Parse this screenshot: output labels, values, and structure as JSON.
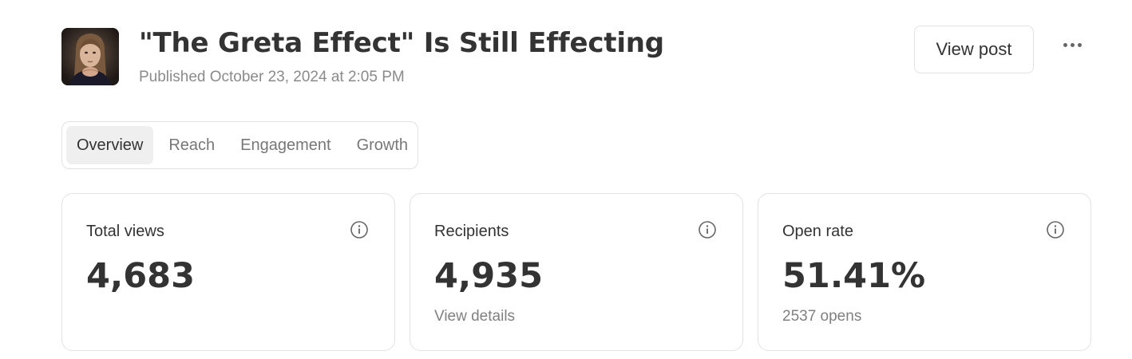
{
  "post": {
    "title": "\"The Greta Effect\" Is Still Effecting",
    "published": "Published October 23, 2024 at 2:05 PM",
    "thumbnail_icon": "portrait-thumbnail"
  },
  "actions": {
    "view_post_label": "View post",
    "more_icon": "ellipsis-icon"
  },
  "tabs": [
    {
      "label": "Overview",
      "active": true
    },
    {
      "label": "Reach",
      "active": false
    },
    {
      "label": "Engagement",
      "active": false
    },
    {
      "label": "Growth",
      "active": false
    }
  ],
  "stats": [
    {
      "label": "Total views",
      "value": "4,683",
      "sub": ""
    },
    {
      "label": "Recipients",
      "value": "4,935",
      "sub": "View details"
    },
    {
      "label": "Open rate",
      "value": "51.41%",
      "sub": "2537 opens"
    }
  ],
  "colors": {
    "text_primary": "#333333",
    "text_muted": "#808080",
    "border": "#e2e2e2",
    "active_tab_bg": "#efefef"
  }
}
